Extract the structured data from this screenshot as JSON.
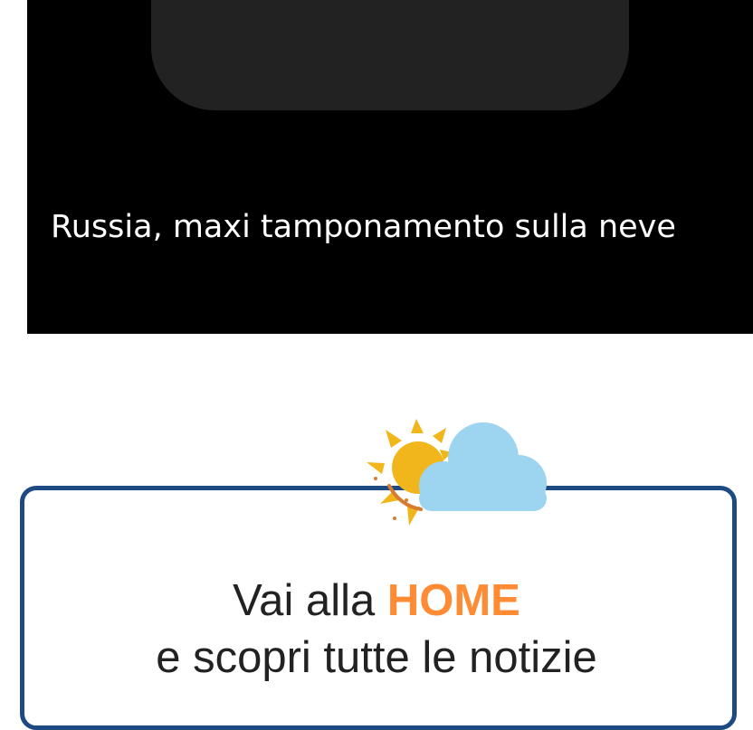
{
  "video": {
    "title": "Russia, maxi tamponamento sulla neve"
  },
  "home_banner": {
    "line1_prefix": "Vai alla",
    "line1_highlight": "HOME",
    "line2": "e scopri tutte le notizie",
    "icon": "weather-sun-cloud-icon",
    "border_color": "#1d4a82",
    "highlight_color": "#ff8b34"
  }
}
